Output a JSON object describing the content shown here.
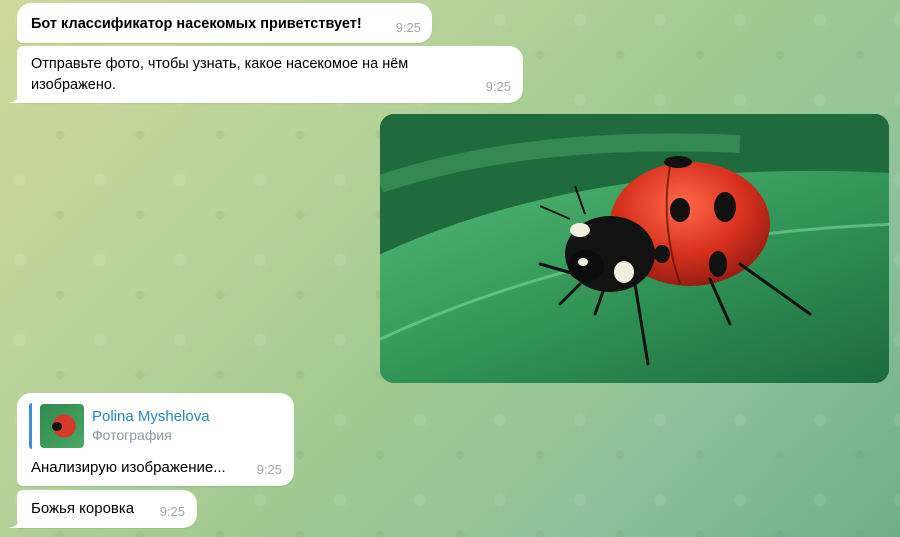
{
  "messages": [
    {
      "text": "Бот классификатор насекомых приветствует!",
      "time": "9:25"
    },
    {
      "text": "Отправьте фото, чтобы узнать, какое насекомое на нём изображено.",
      "time": "9:25"
    },
    {
      "reply": {
        "name": "Polina Myshelova",
        "sub": "Фотография"
      },
      "text": "Анализирую изображение...",
      "time": "9:25"
    },
    {
      "text": "Божья коровка",
      "time": "9:25"
    }
  ],
  "photo": {
    "subject": "ladybug-on-leaf-photo"
  },
  "colors": {
    "bubble": "#ffffff",
    "time": "#a0a8a0",
    "reply_accent": "#3a8fd8",
    "reply_name": "#2b83c9"
  }
}
